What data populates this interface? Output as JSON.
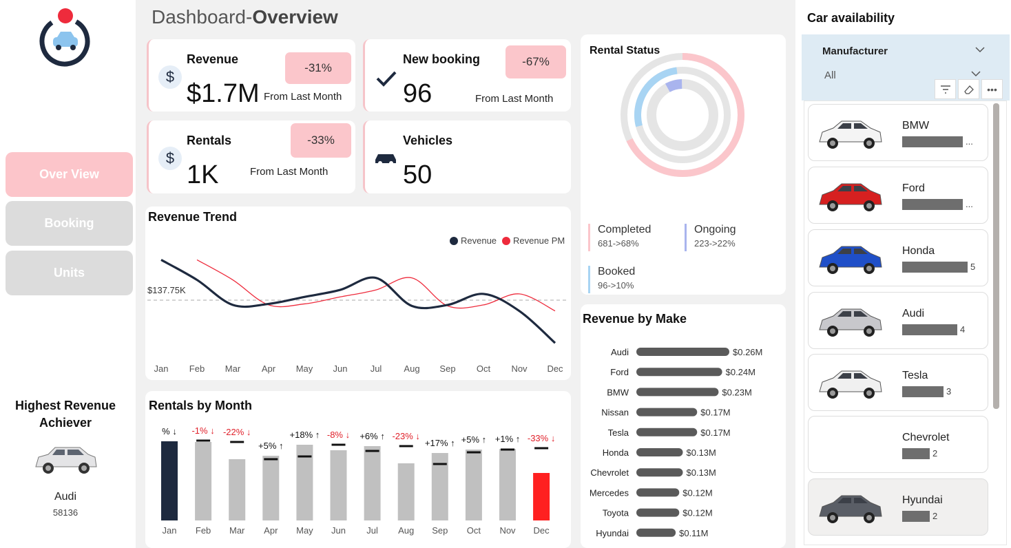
{
  "page": {
    "title_light": "Dashboard-",
    "title_bold": "Overview"
  },
  "nav": [
    {
      "label": "Over View",
      "active": true
    },
    {
      "label": "Booking",
      "active": false
    },
    {
      "label": "Units",
      "active": false
    }
  ],
  "achiever": {
    "heading": "Highest Revenue Achiever",
    "name": "Audi",
    "value": "58136"
  },
  "kpis": {
    "revenue": {
      "title": "Revenue",
      "value": "$1.7M",
      "change": "-31%",
      "sub": "From Last Month"
    },
    "new_booking": {
      "title": "New booking",
      "value": "96",
      "change": "-67%",
      "sub": "From Last Month"
    },
    "rentals": {
      "title": "Rentals",
      "value": "1K",
      "change": "-33%",
      "sub": "From Last Month"
    },
    "vehicles": {
      "title": "Vehicles",
      "value": "50"
    }
  },
  "revenue_trend": {
    "title": "Revenue Trend",
    "legend": [
      "Revenue",
      "Revenue PM"
    ],
    "avg_label": "$137.75K"
  },
  "rentals_by_month": {
    "title": "Rentals by Month"
  },
  "rental_status": {
    "title": "Rental Status",
    "items": [
      {
        "label": "Completed",
        "value": "681->68%",
        "color": "#fbc6cb"
      },
      {
        "label": "Ongoing",
        "value": "223->22%",
        "color": "#a9b4ee"
      },
      {
        "label": "Booked",
        "value": "96->10%",
        "color": "#a8d4f3"
      }
    ]
  },
  "revenue_by_make": {
    "title": "Revenue by Make"
  },
  "car_availability": {
    "title": "Car availability",
    "filter_label": "Manufacturer",
    "filter_value": "All",
    "cars": [
      {
        "name": "BMW",
        "count": "...",
        "color": "#f4f4f4"
      },
      {
        "name": "Ford",
        "count": "...",
        "color": "#d62020"
      },
      {
        "name": "Honda",
        "count": "5",
        "color": "#1f4fc8"
      },
      {
        "name": "Audi",
        "count": "4",
        "color": "#c8c8cc"
      },
      {
        "name": "Tesla",
        "count": "3",
        "color": "#f0f0f0"
      },
      {
        "name": "Chevrolet",
        "count": "2",
        "color": ""
      },
      {
        "name": "Hyundai",
        "count": "2",
        "color": "#5a5e66"
      }
    ]
  },
  "colors": {
    "accent_pink": "#fbc6cb",
    "navy": "#1e2a3f",
    "red": "#ee2b3c",
    "gray_bar": "#c0c0c0"
  },
  "chart_data": [
    {
      "type": "line",
      "title": "Revenue Trend",
      "x": [
        "Jan",
        "Feb",
        "Mar",
        "Apr",
        "May",
        "Jun",
        "Jul",
        "Aug",
        "Sep",
        "Oct",
        "Nov",
        "Dec"
      ],
      "series": [
        {
          "name": "Revenue",
          "color": "#1e2a3f",
          "values": [
            178,
            158,
            133,
            134,
            141,
            148,
            160,
            132,
            133,
            144,
            127,
            95
          ]
        },
        {
          "name": "Revenue PM",
          "color": "#ee2b3c",
          "values": [
            null,
            178,
            158,
            133,
            134,
            141,
            148,
            160,
            132,
            133,
            144,
            127
          ]
        }
      ],
      "reference_line": 137.75,
      "ylim": [
        80,
        190
      ]
    },
    {
      "type": "bar",
      "title": "Rentals by Month",
      "categories": [
        "Jan",
        "Feb",
        "Mar",
        "Apr",
        "May",
        "Jun",
        "Jul",
        "Aug",
        "Sep",
        "Oct",
        "Nov",
        "Dec"
      ],
      "values": [
        115,
        114,
        89,
        94,
        110,
        102,
        108,
        83,
        98,
        103,
        104,
        69
      ],
      "previous": [
        null,
        116,
        114,
        89,
        93,
        110,
        101,
        108,
        82,
        99,
        103,
        105
      ],
      "labels": [
        "% ↓",
        "-1% ↓",
        "-22% ↓",
        "+5% ↑",
        "+18% ↑",
        "-8% ↓",
        "+6% ↑",
        "-23% ↓",
        "+17% ↑",
        "+5% ↑",
        "+1% ↑",
        "-33% ↓"
      ],
      "label_negative": [
        false,
        true,
        true,
        false,
        false,
        true,
        false,
        true,
        false,
        false,
        false,
        true
      ],
      "bar_colors": [
        "#1e2a3f",
        "#c0c0c0",
        "#c0c0c0",
        "#c0c0c0",
        "#c0c0c0",
        "#c0c0c0",
        "#c0c0c0",
        "#c0c0c0",
        "#c0c0c0",
        "#c0c0c0",
        "#c0c0c0",
        "#ff2020"
      ]
    },
    {
      "type": "pie",
      "title": "Rental Status",
      "categories": [
        "Completed",
        "Ongoing",
        "Booked"
      ],
      "values": [
        68,
        22,
        10
      ]
    },
    {
      "type": "bar",
      "title": "Revenue by Make",
      "categories": [
        "Audi",
        "Ford",
        "BMW",
        "Nissan",
        "Tesla",
        "Honda",
        "Chevrolet",
        "Mercedes",
        "Toyota",
        "Hyundai"
      ],
      "values": [
        0.26,
        0.24,
        0.23,
        0.17,
        0.17,
        0.13,
        0.13,
        0.12,
        0.12,
        0.11
      ],
      "labels": [
        "$0.26M",
        "$0.24M",
        "$0.23M",
        "$0.17M",
        "$0.17M",
        "$0.13M",
        "$0.13M",
        "$0.12M",
        "$0.12M",
        "$0.11M"
      ]
    }
  ]
}
